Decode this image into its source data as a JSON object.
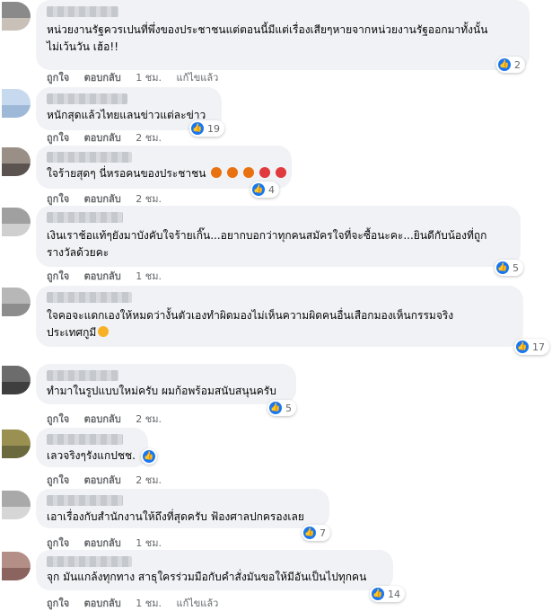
{
  "labels": {
    "like": "ถูกใจ",
    "reply": "ตอบกลับ",
    "edited": "แก้ไขแล้ว"
  },
  "comments": [
    {
      "lines": [
        "หน่วยงานรัฐควรเปนที่พึ่งของประชาชนแต่ตอนนี้มีแต่เรื่องเสียๆหายจากหน่วยงานรัฐออกมาทั้งนั้น",
        "ไม่เว้นวัน เฮ้อ!!"
      ],
      "time": "1 ชม.",
      "edited": true,
      "likes": "2",
      "avatar_colors": [
        "#8a8a8a",
        "#c9c0b8"
      ]
    },
    {
      "lines": [
        "หนักสุดแล้วไทยแลนข่าวแต่ละข่าว"
      ],
      "time": "2 ชม.",
      "edited": false,
      "likes": "19",
      "avatar_colors": [
        "#c7d9ef",
        "#9eb9d8"
      ]
    },
    {
      "lines": [
        "ใจร้ายสุดๆ นี่หรอคนของประชาชน"
      ],
      "emoji": [
        "rage",
        "rage",
        "rage",
        "angry",
        "angry"
      ],
      "time": "2 ชม.",
      "edited": false,
      "likes": "4",
      "avatar_colors": [
        "#9a8f86",
        "#5a5350"
      ]
    },
    {
      "lines": [
        "เงินเราช้อแท้ๆยังมาบังคับใจร้ายเกิ๊น...อยากบอกว่าทุกคนสมัครใจที่จะซื้อนะคะ...ยินดีกับน้องที่ถูก",
        "รางวัลด้วยคะ"
      ],
      "time": "1 ชม.",
      "edited": false,
      "likes": "5",
      "avatar_colors": [
        "#a0a0a0",
        "#cfcfcf"
      ]
    },
    {
      "lines": [
        "ใจคอจะแดกเองให้หมดว่างั้นตัวเองทำผิดมองไม่เห็นความผิดคนอื่นเสือกมองเห็นกรรมจริง",
        "ประเทศกูมี"
      ],
      "emoji_end": "sad",
      "time": "",
      "edited": false,
      "likes": "17",
      "avatar_colors": [
        "#b7b7b7",
        "#8d8d8d"
      ]
    },
    {
      "lines": [
        "ทำมาในรูปแบบใหม่ครับ ผมก้อพร้อมสนับสนุนครับ"
      ],
      "time": "2 ชม.",
      "edited": false,
      "likes": "5",
      "avatar_colors": [
        "#6c6c6c",
        "#3f3f3f"
      ]
    },
    {
      "lines": [
        "เลวจริงๆรังแกปชช."
      ],
      "time": "2 ชม.",
      "edited": false,
      "likes": "",
      "avatar_colors": [
        "#9a9052",
        "#6b6a3f"
      ]
    },
    {
      "lines": [
        "เอาเรื่องกับสำนักงานให้ถึงที่สุดครับ ฟ้องศาลปกครองเลย"
      ],
      "time": "1 ชม.",
      "edited": false,
      "likes": "7",
      "avatar_colors": [
        "#a9a9a9",
        "#d6d6d6"
      ]
    },
    {
      "lines": [
        "จุก มันแกล้งทุกทาง สาธุใครร่วมมือกับคำสั่งมันขอให้มีอันเป็นไปทุกคน"
      ],
      "time": "1 ชม.",
      "edited": true,
      "likes": "14",
      "avatar_colors": [
        "#b48f88",
        "#8b6460"
      ]
    }
  ],
  "colors": {
    "like": "#1877f2",
    "bubble": "#f0f2f5",
    "meta": "#65676b",
    "rage": "#e9710f",
    "angry": "#e0393e",
    "sad": "#f7b125"
  }
}
